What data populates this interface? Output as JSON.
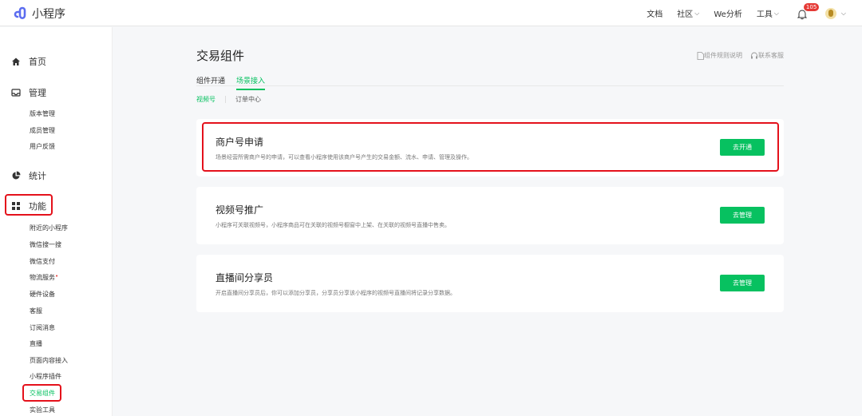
{
  "app": {
    "title": "小程序"
  },
  "topnav": {
    "docs": "文档",
    "community": "社区",
    "analytics": "We分析",
    "tools": "工具",
    "notification_count": "105"
  },
  "sidebar": {
    "home": "首页",
    "manage": {
      "label": "管理",
      "items": [
        "版本管理",
        "成员管理",
        "用户反馈"
      ]
    },
    "stats": "统计",
    "features": {
      "label": "功能",
      "items": [
        "附近的小程序",
        "微信搜一搜",
        "微信支付",
        "物流服务",
        "硬件设备",
        "客服",
        "订阅消息",
        "直播",
        "页面内容接入",
        "小程序插件",
        "交易组件",
        "实验工具"
      ]
    }
  },
  "main": {
    "title": "交易组件",
    "links": {
      "rules": "组件规则说明",
      "support": "联系客服"
    },
    "tabs": [
      "组件开通",
      "场景接入"
    ],
    "subtabs": [
      "视频号",
      "订单中心"
    ],
    "cards": [
      {
        "title": "商户号申请",
        "desc": "场景经营所需商户号的申请，可以查看小程序使用该商户号产生的交易金额、流水、申请、管理及操作。",
        "button": "去开通"
      },
      {
        "title": "视频号推广",
        "desc": "小程序可关联视频号，小程序商品可在关联的视频号橱窗中上架、在关联的视频号直播中售卖。",
        "button": "去管理"
      },
      {
        "title": "直播间分享员",
        "desc": "开启直播间分享员后，你可以添加分享员，分享员分享该小程序的视频号直播间将记录分享数据。",
        "button": "去管理"
      }
    ]
  },
  "colors": {
    "accent": "#07c160",
    "highlight": "#e4111b"
  }
}
